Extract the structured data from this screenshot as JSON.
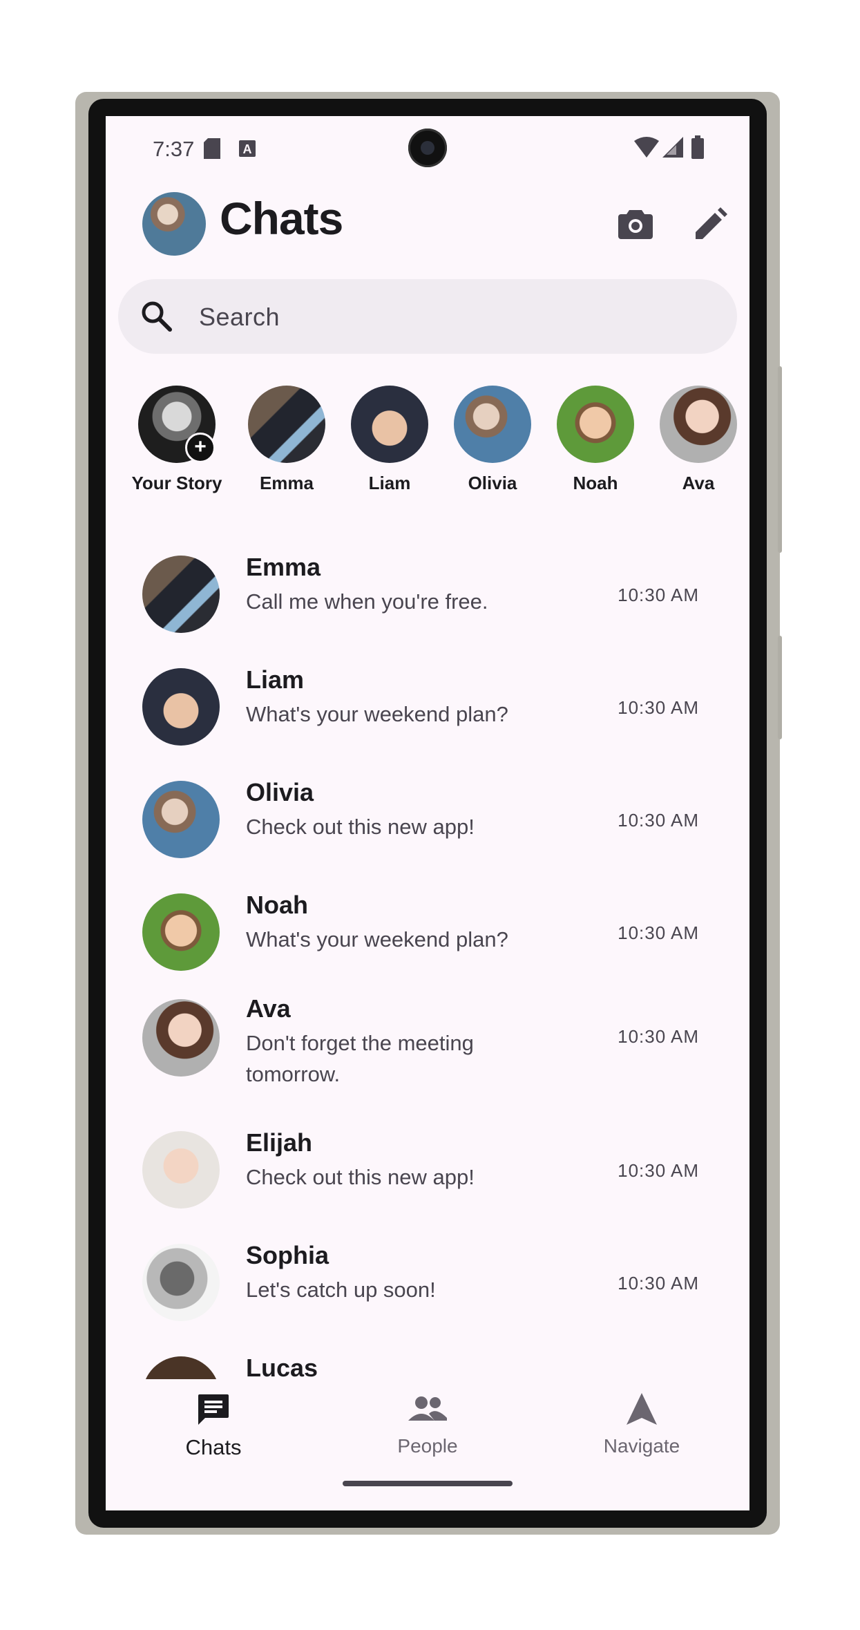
{
  "status_bar": {
    "time": "7:37"
  },
  "header": {
    "title": "Chats"
  },
  "search": {
    "placeholder": "Search"
  },
  "stories": [
    {
      "name": "Your Story"
    },
    {
      "name": "Emma"
    },
    {
      "name": "Liam"
    },
    {
      "name": "Olivia"
    },
    {
      "name": "Noah"
    },
    {
      "name": "Ava"
    }
  ],
  "chats": [
    {
      "name": "Emma",
      "message": "Call me when you're free.",
      "time": "10:30 AM"
    },
    {
      "name": "Liam",
      "message": "What's your weekend plan?",
      "time": "10:30 AM"
    },
    {
      "name": "Olivia",
      "message": "Check out this new app!",
      "time": "10:30 AM"
    },
    {
      "name": "Noah",
      "message": "What's your weekend plan?",
      "time": "10:30 AM"
    },
    {
      "name": "Ava",
      "message": "Don't forget the meeting tomorrow.",
      "time": "10:30 AM"
    },
    {
      "name": "Elijah",
      "message": "Check out this new app!",
      "time": "10:30 AM"
    },
    {
      "name": "Sophia",
      "message": "Let's catch up soon!",
      "time": "10:30 AM"
    },
    {
      "name": "Lucas",
      "message": "",
      "time": ""
    }
  ],
  "bottom_nav": {
    "chats": "Chats",
    "people": "People",
    "navigate": "Navigate"
  },
  "colors": {
    "background": "#fdf7fc",
    "search_bg": "#f0ebf1",
    "text_primary": "#1c1b1f",
    "text_secondary": "#49454f"
  }
}
